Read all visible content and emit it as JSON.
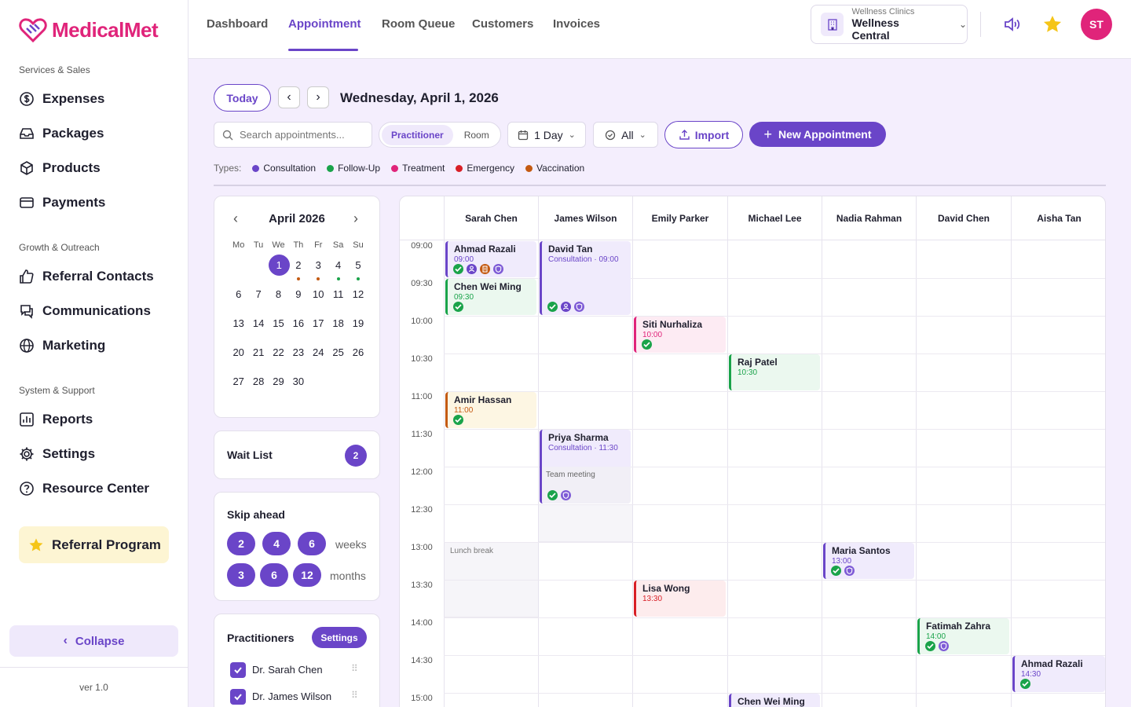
{
  "brand": {
    "name": "MedicalMet",
    "color": "#e0247a"
  },
  "sidebar": {
    "section1": "Services & Sales",
    "section2": "Growth & Outreach",
    "section3": "System & Support",
    "items": [
      {
        "label": "Expenses",
        "icon": "dollar-icon"
      },
      {
        "label": "Packages",
        "icon": "inbox-icon"
      },
      {
        "label": "Products",
        "icon": "box-icon"
      },
      {
        "label": "Payments",
        "icon": "card-icon"
      },
      {
        "label": "Referral Contacts",
        "icon": "thumbs-up-icon"
      },
      {
        "label": "Communications",
        "icon": "chat-icon"
      },
      {
        "label": "Marketing",
        "icon": "globe-icon"
      },
      {
        "label": "Reports",
        "icon": "chart-icon"
      },
      {
        "label": "Settings",
        "icon": "gear-icon"
      },
      {
        "label": "Resource Center",
        "icon": "help-icon"
      }
    ],
    "referral": "Referral Program",
    "collapse": "Collapse",
    "version": "ver 1.0"
  },
  "topnav": {
    "tabs": [
      "Dashboard",
      "Appointment",
      "Room Queue",
      "Customers",
      "Invoices"
    ],
    "active_tab": "Appointment",
    "clinic_group": "Wellness Clinics",
    "clinic_name": "Wellness Central",
    "avatar_initials": "ST"
  },
  "toolbar": {
    "today": "Today",
    "date": "Wednesday, April 1, 2026",
    "search_placeholder": "Search appointments...",
    "view_options": [
      "Practitioner",
      "Room"
    ],
    "range": "1 Day",
    "filter": "All",
    "import": "Import",
    "new_appointment": "New Appointment"
  },
  "types": {
    "label": "Types:",
    "items": [
      {
        "name": "Consultation",
        "color": "#6a45c8"
      },
      {
        "name": "Follow-Up",
        "color": "#1aa34a"
      },
      {
        "name": "Treatment",
        "color": "#e0247a"
      },
      {
        "name": "Emergency",
        "color": "#d81f26"
      },
      {
        "name": "Vaccination",
        "color": "#c45a12"
      }
    ]
  },
  "calendar": {
    "month": "April 2026",
    "dow": [
      "Mo",
      "Tu",
      "We",
      "Th",
      "Fr",
      "Sa",
      "Su"
    ],
    "selected": 1
  },
  "waitlist": {
    "label": "Wait List",
    "count": "2"
  },
  "skip": {
    "title": "Skip ahead",
    "weeks": [
      "2",
      "4",
      "6"
    ],
    "weeks_label": "weeks",
    "months": [
      "3",
      "6",
      "12"
    ],
    "months_label": "months"
  },
  "practitioners": {
    "title": "Practitioners",
    "settings": "Settings",
    "list": [
      "Dr. Sarah Chen",
      "Dr. James Wilson"
    ]
  },
  "schedule": {
    "columns": [
      "Sarah Chen",
      "James Wilson",
      "Emily Parker",
      "Michael Lee",
      "Nadia Rahman",
      "David Chen",
      "Aisha Tan"
    ],
    "times": [
      "09:00",
      "09:30",
      "10:00",
      "10:30",
      "11:00",
      "11:30",
      "12:00",
      "12:30",
      "13:00",
      "13:30",
      "14:00",
      "14:30",
      "15:00"
    ],
    "blocks": [
      {
        "label": "",
        "col": 1,
        "start": 12.5,
        "end": 13.0
      },
      {
        "label": "Lunch break",
        "col": 0,
        "start": 13.0,
        "end": 14.0
      }
    ],
    "appointments": [
      {
        "name": "Ahmad Razali",
        "time": "09:00",
        "col": 0,
        "start": 9.0,
        "end": 9.5,
        "type": "consult",
        "icons": [
          "check",
          "person",
          "doc",
          "shield"
        ]
      },
      {
        "name": "Chen Wei Ming",
        "time": "09:30",
        "col": 0,
        "start": 9.5,
        "end": 10.0,
        "type": "follow",
        "icons": [
          "check"
        ]
      },
      {
        "name": "David Tan",
        "time": "Consultation · 09:00",
        "col": 1,
        "start": 9.0,
        "end": 10.0,
        "type": "consult",
        "icons": [
          "check",
          "person",
          "shield"
        ]
      },
      {
        "name": "Siti Nurhaliza",
        "time": "10:00",
        "col": 2,
        "start": 10.0,
        "end": 10.5,
        "type": "treat",
        "icons": [
          "check"
        ]
      },
      {
        "name": "Raj Patel",
        "time": "10:30",
        "col": 3,
        "start": 10.5,
        "end": 11.0,
        "type": "follow",
        "icons": []
      },
      {
        "name": "Amir Hassan",
        "time": "11:00",
        "col": 0,
        "start": 11.0,
        "end": 11.5,
        "type": "vacc",
        "icons": [
          "check"
        ]
      },
      {
        "name": "Priya Sharma",
        "time": "Consultation · 11:30",
        "sub": "Team meeting",
        "col": 1,
        "start": 11.5,
        "end": 12.5,
        "type": "consult",
        "icons": [
          "check",
          "shield"
        ]
      },
      {
        "name": "Maria Santos",
        "time": "13:00",
        "col": 4,
        "start": 13.0,
        "end": 13.5,
        "type": "consult",
        "icons": [
          "check",
          "shield"
        ]
      },
      {
        "name": "Lisa Wong",
        "time": "13:30",
        "col": 2,
        "start": 13.5,
        "end": 14.0,
        "type": "emerg",
        "icons": []
      },
      {
        "name": "Fatimah Zahra",
        "time": "14:00",
        "col": 5,
        "start": 14.0,
        "end": 14.5,
        "type": "follow",
        "icons": [
          "check",
          "shield"
        ]
      },
      {
        "name": "Ahmad Razali",
        "time": "14:30",
        "col": 6,
        "start": 14.5,
        "end": 15.0,
        "type": "consult",
        "icons": [
          "check"
        ]
      },
      {
        "name": "Chen Wei Ming",
        "time": "",
        "col": 3,
        "start": 15.0,
        "end": 15.5,
        "type": "consult",
        "icons": []
      }
    ]
  }
}
